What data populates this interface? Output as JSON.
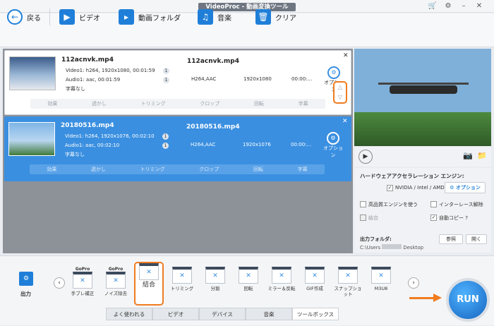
{
  "window": {
    "title": "VideoProc - 動画変換ツール"
  },
  "toolbar": {
    "back": "戻る",
    "video": "ビデオ",
    "folder": "動画フォルダ",
    "music": "音楽",
    "clear": "クリア"
  },
  "items": [
    {
      "name": "112acnvk.mp4",
      "video": "Video1: h264, 1920x1080, 00:01:59",
      "audio": "Audio1: aac, 00:01:59",
      "sub": "字幕なし",
      "out_name": "112acnvk.mp4",
      "codec": "H264,AAC",
      "res": "1920x1080",
      "dur": "00:00:...",
      "opt": "オプション"
    },
    {
      "name": "20180516.mp4",
      "video": "Video1: h264, 1920x1076, 00:02:10",
      "audio": "Audio1: aac, 00:02:10",
      "sub": "字幕なし",
      "out_name": "20180516.mp4",
      "codec": "H264,AAC",
      "res": "1920x1076",
      "dur": "00:00:...",
      "opt": "オプション"
    }
  ],
  "edit": [
    "効果",
    "透かし",
    "トリミング",
    "クロップ",
    "回転",
    "字幕"
  ],
  "settings": {
    "hw": "ハードウェアアクセラレーション エンジン:",
    "gpu": "NVIDIA / Intel / AMD",
    "option": "オプション",
    "hq": "高品質エンジンを使う",
    "deint": "インターレース解除",
    "merge": "結合",
    "autocopy": "自動コピー ?",
    "outlabel": "出力フォルダ:",
    "path": "C:\\Users",
    "path_end": "Desktop",
    "browse": "参照",
    "open": "開く"
  },
  "output_label": "出力",
  "tools": [
    {
      "label": "手ブレ補正",
      "brand": "GoPro"
    },
    {
      "label": "ノイズ除去",
      "brand": "GoPro"
    },
    {
      "label": "結合",
      "brand": ""
    },
    {
      "label": "トリミング",
      "brand": ""
    },
    {
      "label": "分割",
      "brand": ""
    },
    {
      "label": "回転",
      "brand": ""
    },
    {
      "label": "ミラー＆反転",
      "brand": ""
    },
    {
      "label": "GIF作成",
      "brand": ""
    },
    {
      "label": "スナップショット",
      "brand": ""
    },
    {
      "label": "M3U8",
      "brand": ""
    }
  ],
  "tabs": [
    "よく使われる",
    "ビデオ",
    "デバイス",
    "音楽",
    "ツールボックス"
  ],
  "run": "RUN"
}
